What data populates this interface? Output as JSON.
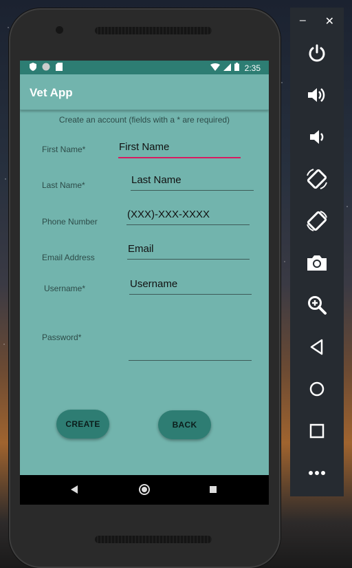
{
  "status_bar": {
    "time": "2:35"
  },
  "app": {
    "title": "Vet App",
    "subtitle": "Create an account (fields with a * are required)"
  },
  "form": {
    "first_name": {
      "label": "First Name*",
      "placeholder": "First Name"
    },
    "last_name": {
      "label": "Last Name*",
      "placeholder": "Last Name"
    },
    "phone": {
      "label": "Phone Number",
      "placeholder": "(XXX)-XXX-XXXX"
    },
    "email": {
      "label": "Email Address",
      "placeholder": "Email"
    },
    "username": {
      "label": "Username*",
      "placeholder": "Username"
    },
    "password": {
      "label": "Password*",
      "placeholder": ""
    }
  },
  "buttons": {
    "create": "CREATE",
    "back": "BACK"
  },
  "emulator_toolbar": {
    "minimize": "–",
    "close": "✕",
    "icons": [
      "power-icon",
      "volume-up-icon",
      "volume-down-icon",
      "rotate-left-icon",
      "rotate-right-icon",
      "camera-icon",
      "zoom-icon",
      "back-icon",
      "home-icon",
      "overview-icon",
      "more-icon"
    ]
  },
  "colors": {
    "accent": "#d81b60",
    "primary": "#72b4ad",
    "primary_dark": "#2d7d73"
  }
}
